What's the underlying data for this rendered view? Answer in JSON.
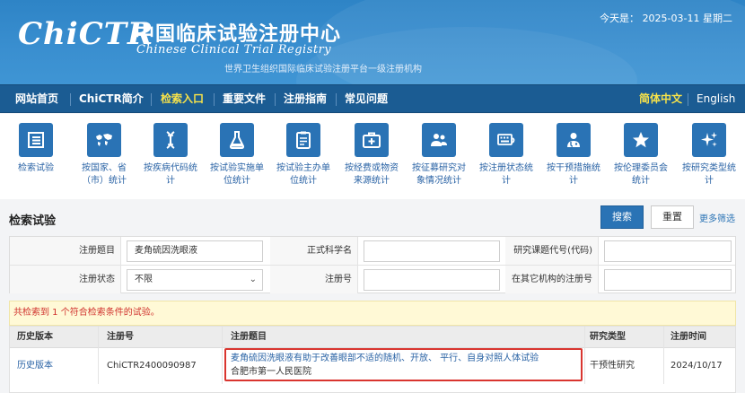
{
  "header": {
    "logo": "ChiCTR",
    "title_cn": "中国临床试验注册中心",
    "title_en": "Chinese Clinical Trial Registry",
    "subtitle": "世界卫生组织国际临床试验注册平台一级注册机构",
    "today_label": "今天是：",
    "today_date": "2025-03-11",
    "weekday": "星期二"
  },
  "nav": {
    "items": [
      "网站首页",
      "ChiCTR简介",
      "检索入口",
      "重要文件",
      "注册指南",
      "常见问题"
    ],
    "lang_cn": "简体中文",
    "lang_en": "English"
  },
  "icon_bar": [
    {
      "icon": "list-icon",
      "label1": "检索试验",
      "label2": ""
    },
    {
      "icon": "world-map-icon",
      "label1": "按国家、省",
      "label2": "（市）统计"
    },
    {
      "icon": "dna-icon",
      "label1": "按疾病代码统",
      "label2": "计"
    },
    {
      "icon": "flask-icon",
      "label1": "按试验实施单",
      "label2": "位统计"
    },
    {
      "icon": "clipboard-icon",
      "label1": "按试验主办单",
      "label2": "位统计"
    },
    {
      "icon": "medkit-icon",
      "label1": "按经费或物资",
      "label2": "来源统计"
    },
    {
      "icon": "people-icon",
      "label1": "按征募研究对",
      "label2": "象情况统计"
    },
    {
      "icon": "keyboard-icon",
      "label1": "按注册状态统",
      "label2": "计"
    },
    {
      "icon": "doctor-icon",
      "label1": "按干预措施统",
      "label2": "计"
    },
    {
      "icon": "star-icon",
      "label1": "按伦理委员会",
      "label2": "统计"
    },
    {
      "icon": "sparkle-icon",
      "label1": "按研究类型统",
      "label2": "计"
    }
  ],
  "search": {
    "title": "检索试验",
    "search_btn": "搜索",
    "reset_btn": "重置",
    "more_filter": "更多筛选",
    "fields": {
      "reg_title_label": "注册题目",
      "reg_title_value": "麦角硫因洗眼液",
      "sci_title_label": "正式科学名",
      "sci_title_value": "",
      "project_code_label": "研究课题代号(代码)",
      "project_code_value": "",
      "status_label": "注册状态",
      "status_value": "不限",
      "reg_no_label": "注册号",
      "reg_no_value": "",
      "other_reg_label": "在其它机构的注册号",
      "other_reg_value": ""
    }
  },
  "results": {
    "notice": "共检索到 1 个符合检索条件的试验。",
    "columns": [
      "历史版本",
      "注册号",
      "注册题目",
      "研究类型",
      "注册时间"
    ],
    "rows": [
      {
        "history": "历史版本",
        "reg_no": "ChiCTR2400090987",
        "title": "麦角硫因洗眼液有助于改善眼部不适的随机、开放、 平行、自身对照人体试验",
        "org": "合肥市第一人民医院",
        "study_type": "干预性研究",
        "reg_date": "2024/10/17"
      }
    ]
  }
}
